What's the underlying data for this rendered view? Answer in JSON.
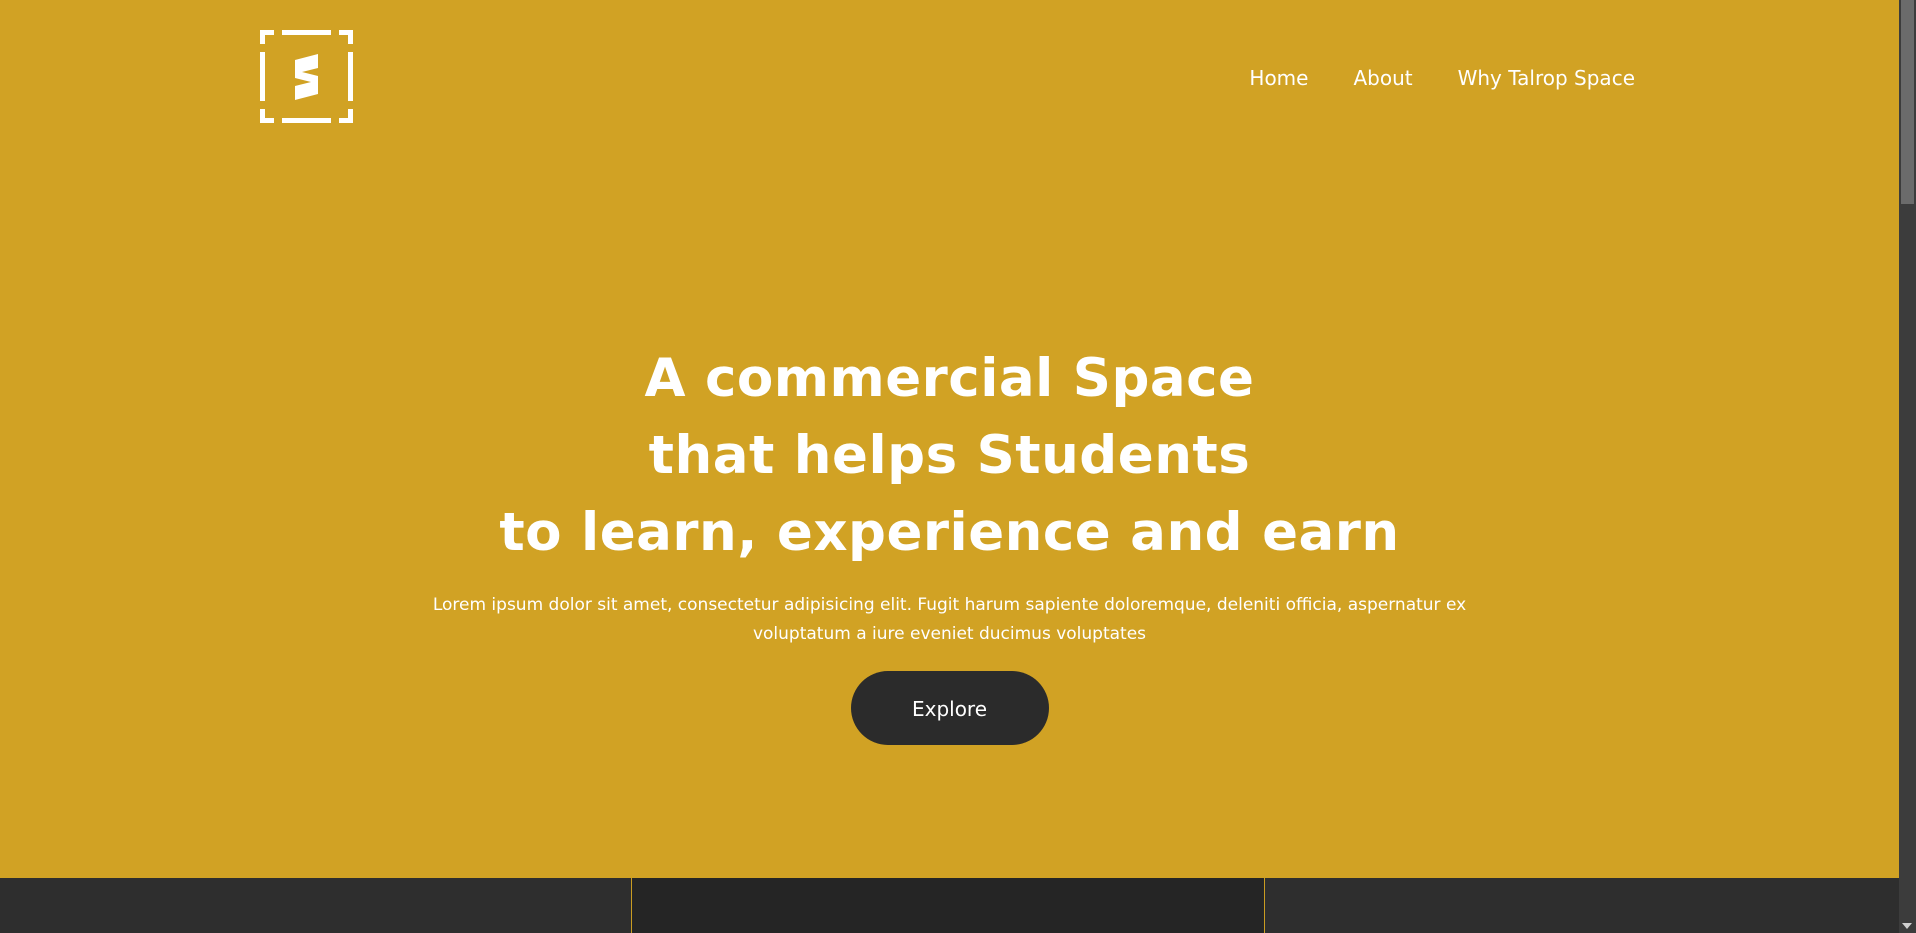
{
  "header": {
    "logo_icon": "talrop-space-s-logo",
    "nav": [
      {
        "label": "Home"
      },
      {
        "label": "About"
      },
      {
        "label": "Why Talrop Space"
      }
    ]
  },
  "hero": {
    "title_lines": [
      "A commercial Space",
      "that helps Students",
      "to learn, experience and earn"
    ],
    "description": "Lorem ipsum dolor sit amet, consectetur adipisicing elit. Fugit harum sapiente doloremque, deleniti officia, aspernatur ex voluptatum a iure eveniet ducimus voluptates",
    "cta_label": "Explore"
  },
  "colors": {
    "background": "#d1a224",
    "button": "#2b2b2b",
    "text": "#ffffff",
    "strip": "#2e2e2e"
  }
}
